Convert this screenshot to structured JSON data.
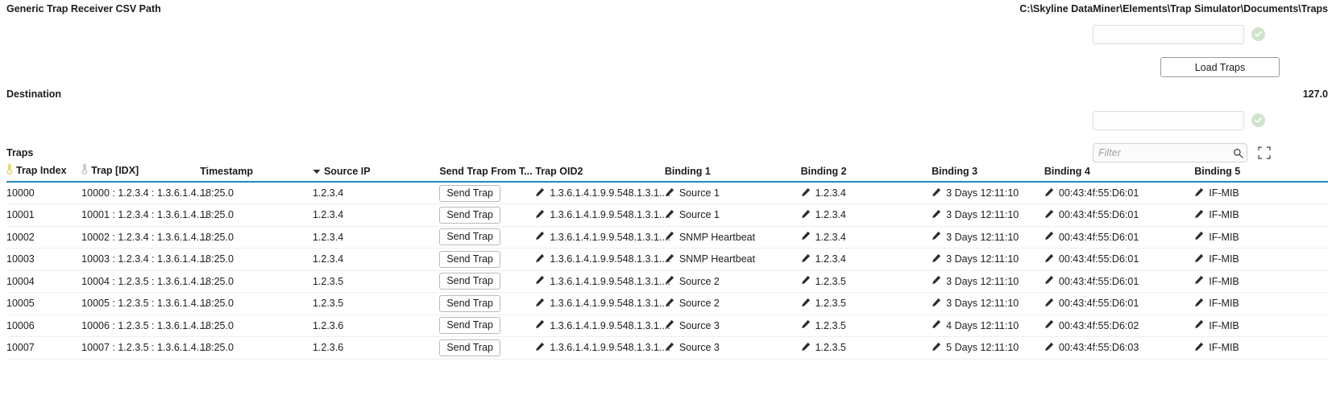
{
  "csv_path_param": {
    "label": "Generic Trap Receiver CSV Path",
    "value": "C:\\Skyline DataMiner\\Elements\\Trap Simulator\\Documents\\Traps",
    "input_value": "",
    "input_placeholder": "",
    "status_icon": "check-circle-icon"
  },
  "load_traps_button": {
    "label": "Load Traps"
  },
  "destination_param": {
    "label": "Destination",
    "value": "127.0",
    "input_value": "",
    "input_placeholder": "",
    "status_icon": "check-circle-icon"
  },
  "traps_section": {
    "title": "Traps",
    "filter": {
      "value": "",
      "placeholder": "Filter",
      "icon": "search-icon"
    },
    "expand_icon": "expand-fullscreen-icon",
    "columns": [
      {
        "key": "trap_index",
        "label": "Trap Index",
        "icon": "primary-key-icon",
        "sort": ""
      },
      {
        "key": "trap_idx",
        "label": "Trap [IDX]",
        "icon": "secondary-key-icon",
        "sort": ""
      },
      {
        "key": "timestamp",
        "label": "Timestamp",
        "icon": "",
        "sort": ""
      },
      {
        "key": "source_ip",
        "label": "Source IP",
        "icon": "",
        "sort": "descending"
      },
      {
        "key": "send_trap",
        "label": "Send Trap From T...",
        "icon": "",
        "sort": ""
      },
      {
        "key": "trap_oid2",
        "label": "Trap OID2",
        "icon": "",
        "sort": ""
      },
      {
        "key": "binding_1",
        "label": "Binding 1",
        "icon": "",
        "sort": ""
      },
      {
        "key": "binding_2",
        "label": "Binding 2",
        "icon": "",
        "sort": ""
      },
      {
        "key": "binding_3",
        "label": "Binding 3",
        "icon": "",
        "sort": ""
      },
      {
        "key": "binding_4",
        "label": "Binding 4",
        "icon": "",
        "sort": ""
      },
      {
        "key": "binding_5",
        "label": "Binding 5",
        "icon": "",
        "sort": ""
      }
    ],
    "send_trap_button_label": "Send Trap",
    "rows": [
      {
        "trap_index": "10000",
        "trap_idx": "10000 : 1.2.3.4 : 1.3.6.1.4....",
        "timestamp": "18:25.0",
        "source_ip": "1.2.3.4",
        "trap_oid2": "1.3.6.1.4.1.9.9.548.1.3.1....",
        "binding_1": "Source 1",
        "binding_2": "1.2.3.4",
        "binding_3": "3 Days 12:11:10",
        "binding_4": "00:43:4f:55:D6:01",
        "binding_5": "IF-MIB"
      },
      {
        "trap_index": "10001",
        "trap_idx": "10001 : 1.2.3.4 : 1.3.6.1.4....",
        "timestamp": "18:25.0",
        "source_ip": "1.2.3.4",
        "trap_oid2": "1.3.6.1.4.1.9.9.548.1.3.1....",
        "binding_1": "Source 1",
        "binding_2": "1.2.3.4",
        "binding_3": "3 Days 12:11:10",
        "binding_4": "00:43:4f:55:D6:01",
        "binding_5": "IF-MIB"
      },
      {
        "trap_index": "10002",
        "trap_idx": "10002 : 1.2.3.4 : 1.3.6.1.4....",
        "timestamp": "18:25.0",
        "source_ip": "1.2.3.4",
        "trap_oid2": "1.3.6.1.4.1.9.9.548.1.3.1....",
        "binding_1": "SNMP Heartbeat",
        "binding_2": "1.2.3.4",
        "binding_3": "3 Days 12:11:10",
        "binding_4": "00:43:4f:55:D6:01",
        "binding_5": "IF-MIB"
      },
      {
        "trap_index": "10003",
        "trap_idx": "10003 : 1.2.3.4 : 1.3.6.1.4....",
        "timestamp": "18:25.0",
        "source_ip": "1.2.3.4",
        "trap_oid2": "1.3.6.1.4.1.9.9.548.1.3.1....",
        "binding_1": "SNMP Heartbeat",
        "binding_2": "1.2.3.4",
        "binding_3": "3 Days 12:11:10",
        "binding_4": "00:43:4f:55:D6:01",
        "binding_5": "IF-MIB"
      },
      {
        "trap_index": "10004",
        "trap_idx": "10004 : 1.2.3.5 : 1.3.6.1.4....",
        "timestamp": "18:25.0",
        "source_ip": "1.2.3.5",
        "trap_oid2": "1.3.6.1.4.1.9.9.548.1.3.1....",
        "binding_1": "Source 2",
        "binding_2": "1.2.3.5",
        "binding_3": "3 Days 12:11:10",
        "binding_4": "00:43:4f:55:D6:01",
        "binding_5": "IF-MIB"
      },
      {
        "trap_index": "10005",
        "trap_idx": "10005 : 1.2.3.5 : 1.3.6.1.4....",
        "timestamp": "18:25.0",
        "source_ip": "1.2.3.5",
        "trap_oid2": "1.3.6.1.4.1.9.9.548.1.3.1....",
        "binding_1": "Source 2",
        "binding_2": "1.2.3.5",
        "binding_3": "3 Days 12:11:10",
        "binding_4": "00:43:4f:55:D6:01",
        "binding_5": "IF-MIB"
      },
      {
        "trap_index": "10006",
        "trap_idx": "10006 : 1.2.3.5 : 1.3.6.1.4....",
        "timestamp": "18:25.0",
        "source_ip": "1.2.3.6",
        "trap_oid2": "1.3.6.1.4.1.9.9.548.1.3.1....",
        "binding_1": "Source 3",
        "binding_2": "1.2.3.5",
        "binding_3": "4 Days 12:11:10",
        "binding_4": "00:43:4f:55:D6:02",
        "binding_5": "IF-MIB"
      },
      {
        "trap_index": "10007",
        "trap_idx": "10007 : 1.2.3.5 : 1.3.6.1.4....",
        "timestamp": "18:25.0",
        "source_ip": "1.2.3.6",
        "trap_oid2": "1.3.6.1.4.1.9.9.548.1.3.1....",
        "binding_1": "Source 3",
        "binding_2": "1.2.3.5",
        "binding_3": "5 Days 12:11:10",
        "binding_4": "00:43:4f:55:D6:03",
        "binding_5": "IF-MIB"
      }
    ]
  },
  "colors": {
    "header_underline": "#2586c6",
    "ok_badge": "#cfe5cb",
    "primary_key": "#e8d96a",
    "secondary_key": "#c6c6c6"
  }
}
